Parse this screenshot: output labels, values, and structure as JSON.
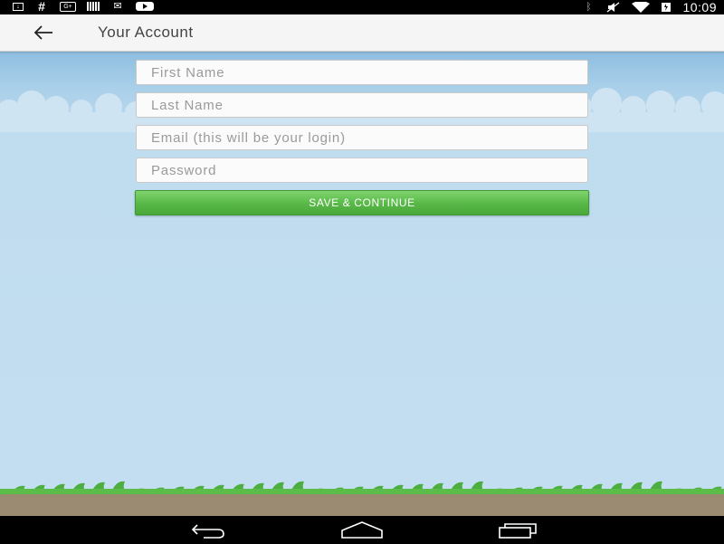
{
  "status_bar": {
    "left_icons": [
      "download-icon",
      "hash-icon",
      "google-plus-icon",
      "barcode-icon",
      "email-icon",
      "youtube-icon"
    ],
    "right_icons": [
      "bluetooth-icon",
      "mute-icon",
      "wifi-icon",
      "battery-icon"
    ],
    "time": "10:09"
  },
  "app_bar": {
    "title": "Your Account",
    "back_icon": "arrow-left-icon"
  },
  "form": {
    "first_name": {
      "placeholder": "First Name",
      "value": ""
    },
    "last_name": {
      "placeholder": "Last Name",
      "value": ""
    },
    "email": {
      "placeholder": "Email (this will be your login)",
      "value": ""
    },
    "password": {
      "placeholder": "Password",
      "value": ""
    },
    "save_label": "SAVE & CONTINUE"
  },
  "colors": {
    "sky": "#c3def0",
    "button_green": "#58b847",
    "grass_green": "#4cae3e",
    "ground": "#9b8b73",
    "app_bar": "#f5f5f5"
  },
  "nav_bar": {
    "buttons": [
      "back-icon",
      "home-icon",
      "recent-apps-icon"
    ]
  }
}
